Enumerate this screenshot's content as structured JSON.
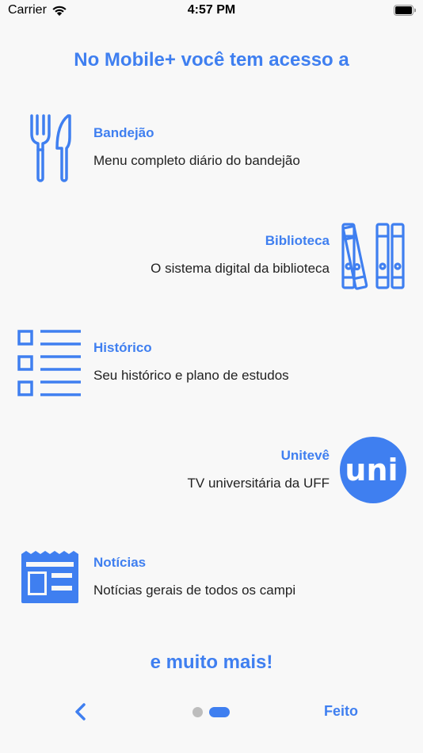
{
  "status_bar": {
    "carrier": "Carrier",
    "time": "4:57 PM"
  },
  "headline": "No Mobile+ você tem acesso a",
  "features": [
    {
      "title": "Bandejão",
      "description": "Menu completo diário do bandejão",
      "icon": "fork-knife-icon"
    },
    {
      "title": "Biblioteca",
      "description": "O sistema digital da biblioteca",
      "icon": "books-icon"
    },
    {
      "title": "Histórico",
      "description": "Seu histórico e plano de estudos",
      "icon": "checklist-icon"
    },
    {
      "title": "Unitevê",
      "description": "TV universitária da UFF",
      "icon": "uni-logo",
      "logo_text": "uni"
    },
    {
      "title": "Notícias",
      "description": "Notícias gerais de todos os campi",
      "icon": "newspaper-icon"
    }
  ],
  "footer_text": "e muito mais!",
  "navigation": {
    "back_icon": "chevron-left-icon",
    "done_label": "Feito",
    "page_count": 2,
    "current_page": 2
  },
  "colors": {
    "accent": "#3f7ff0",
    "text": "#222222",
    "background": "#f8f8f8",
    "dot_inactive": "#bdbdbd"
  }
}
